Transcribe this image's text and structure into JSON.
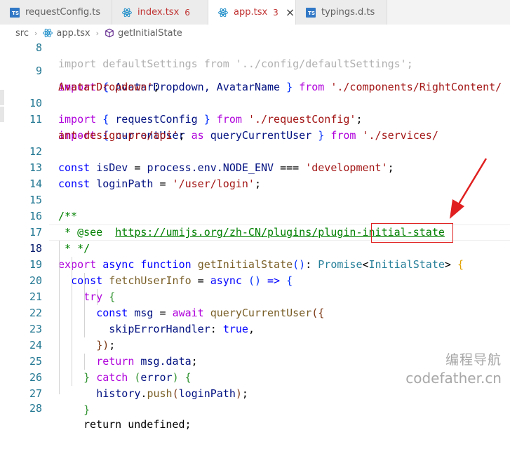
{
  "tabs": [
    {
      "label": "requestConfig.ts",
      "icon": "typescript-icon",
      "active": false
    },
    {
      "label": "index.tsx",
      "icon": "react-icon",
      "problems": "6",
      "active": false
    },
    {
      "label": "app.tsx",
      "icon": "react-icon",
      "problems": "3",
      "active": true,
      "close": "×"
    },
    {
      "label": "typings.d.ts",
      "icon": "typescript-icon",
      "active": false
    }
  ],
  "breadcrumb": {
    "folder": "src",
    "file": "app.tsx",
    "symbol": "getInitialState",
    "separator": "›"
  },
  "line_numbers": [
    "8",
    "9",
    "10",
    "11",
    "12",
    "13",
    "14",
    "15",
    "16",
    "17",
    "18",
    "19",
    "20",
    "21",
    "22",
    "23",
    "24",
    "25",
    "26",
    "27",
    "28"
  ],
  "code": {
    "l8": "import defaultSettings from '../config/defaultSettings';",
    "l9a_import": "import",
    "l9a_names": "AvatarDropdown, AvatarName",
    "l9a_from": "from",
    "l9a_path": "'./components/RightContent/",
    "l9b_path": "AvatarDropdown'",
    "l10_names": "requestConfig",
    "l10_path": "'./requestConfig'",
    "l11_names": "currentUser",
    "l11_as": "as",
    "l11_alias": "queryCurrentUser",
    "l11_path": "'./services/",
    "l11b_path": "ant-design-pro/api'",
    "l12_const": "const",
    "l12_name": "isDev",
    "l12_expr": "process.env.NODE_ENV",
    "l12_str": "'development'",
    "l13_name": "loginPath",
    "l13_str": "'/user/login'",
    "l15": "/**",
    "l16_tag": " * @see",
    "l16_url": "https://umijs.org/zh-CN/plugins/plugin-initial-state",
    "l17": " * */",
    "l18_export": "export",
    "l18_async": "async",
    "l18_function": "function",
    "l18_name": "getInitialState",
    "l18_promise": "Promise",
    "l18_type": "InitialState",
    "l19_name": "fetchUserInfo",
    "l20_try": "try",
    "l21_name": "msg",
    "l21_await": "await",
    "l21_fn": "queryCurrentUser",
    "l22_prop": "skipErrorHandler",
    "l22_val": "true",
    "l24_return": "return",
    "l24_expr": "msg.data",
    "l25_catch": "catch",
    "l25_err": "error",
    "l26_obj": "history",
    "l26_fn": "push",
    "l26_arg": "loginPath",
    "l28": "return undefined;"
  },
  "watermark": {
    "line1": "编程导航",
    "line2": "codefather.cn"
  },
  "colors": {
    "annotation_red": "#e02020",
    "keyword": "#0000ff",
    "string": "#a31515",
    "comment": "#008000"
  }
}
